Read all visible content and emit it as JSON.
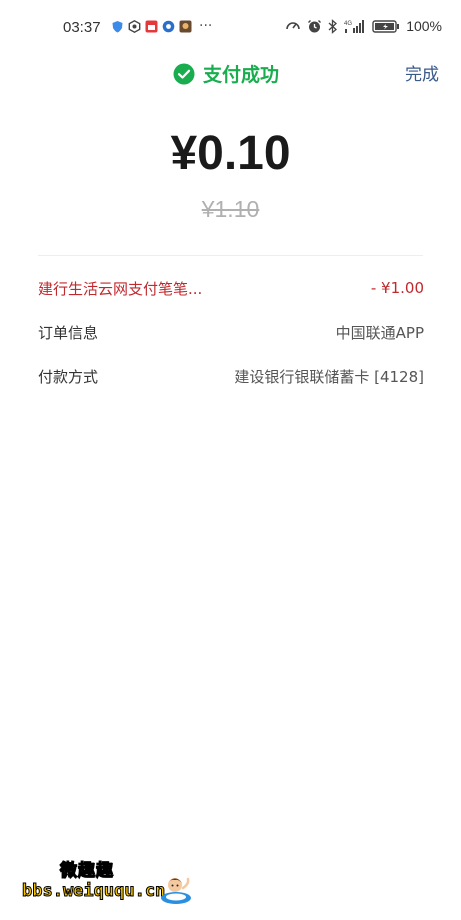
{
  "status_bar": {
    "time": "03:37",
    "dots": "···",
    "battery": "100%"
  },
  "header": {
    "title": "支付成功",
    "done_label": "完成"
  },
  "payment": {
    "amount": "¥0.10",
    "original_amount": "¥1.10"
  },
  "details": [
    {
      "label": "建行生活云网支付笔笔...",
      "value": "- ¥1.00"
    },
    {
      "label": "订单信息",
      "value": "中国联通APP"
    },
    {
      "label": "付款方式",
      "value": "建设银行银联储蓄卡 [4128]"
    }
  ],
  "watermark": {
    "top": "微趣趣",
    "bottom": "bbs.weiququ.cn"
  },
  "colors": {
    "success_green": "#1aad50",
    "discount_red": "#c1292e",
    "done_blue": "#3a5a8a"
  }
}
